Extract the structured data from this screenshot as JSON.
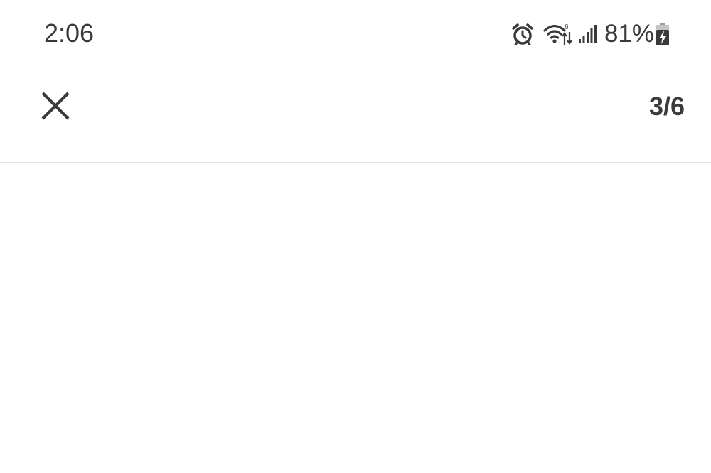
{
  "status_bar": {
    "time": "2:06",
    "battery_percent": "81%",
    "icons": [
      "alarm-icon",
      "wifi-icon",
      "signal-icon",
      "battery-charging-icon"
    ]
  },
  "toolbar": {
    "close_icon": "close-icon",
    "page_counter": "3/6"
  },
  "colors": {
    "background": "#ffffff",
    "text": "#3a3a3a",
    "divider": "#e3e3e3"
  }
}
